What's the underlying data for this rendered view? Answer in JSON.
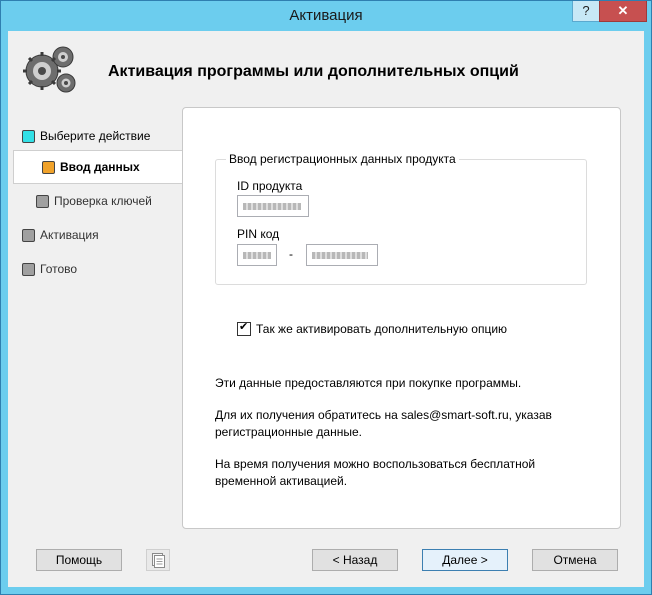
{
  "window": {
    "title": "Активация",
    "help_glyph": "?",
    "close_glyph": "✕"
  },
  "header": {
    "title": "Активация программы или дополнительных опций",
    "icon": "gears-icon"
  },
  "steps": [
    {
      "label": "Выберите действие",
      "color": "#33e0e6",
      "state": "done"
    },
    {
      "label": "Ввод данных",
      "color": "#f0a22a",
      "state": "active"
    },
    {
      "label": "Проверка ключей",
      "color": "#a0a0a0",
      "state": "pending"
    },
    {
      "label": "Активация",
      "color": "#a0a0a0",
      "state": "pending"
    },
    {
      "label": "Готово",
      "color": "#a0a0a0",
      "state": "pending"
    }
  ],
  "form": {
    "group_title": "Ввод регистрационных данных продукта",
    "product_id_label": "ID продукта",
    "pin_label": "PIN код",
    "pin_separator": "-",
    "extra_options_checkbox_label": "Так же активировать дополнительную опцию",
    "extra_options_checked": true
  },
  "info": {
    "line1": "Эти данные предоставляются при покупке программы.",
    "line2": "Для их получения обратитесь на sales@smart-soft.ru, указав регистрационные данные.",
    "line3": "На время получения можно воспользоваться бесплатной временной активацией."
  },
  "buttons": {
    "help": "Помощь",
    "back": "< Назад",
    "next": "Далее >",
    "cancel": "Отмена",
    "doc_icon": "document-icon"
  }
}
